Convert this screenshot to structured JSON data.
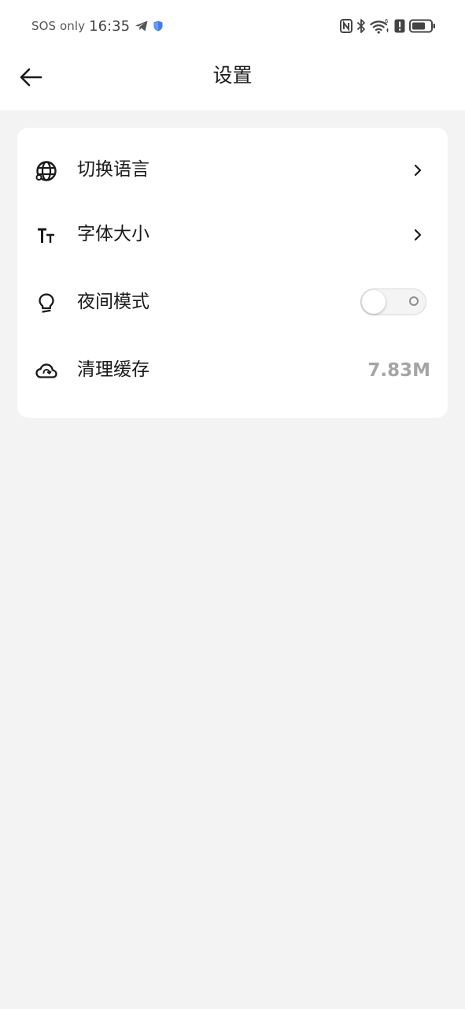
{
  "status_bar": {
    "carrier": "SOS only",
    "time": "16:35",
    "icons": [
      "telegram-icon",
      "shield-icon",
      "nfc-icon",
      "bluetooth-icon",
      "wifi-icon",
      "alert-icon",
      "battery-icon"
    ],
    "wifi_badge": "6"
  },
  "header": {
    "title": "设置",
    "back_icon": "arrow-left-icon"
  },
  "settings": {
    "language": {
      "label": "切换语言",
      "icon": "globe-icon"
    },
    "font_size": {
      "label": "字体大小",
      "icon": "text-size-icon"
    },
    "night_mode": {
      "label": "夜间模式",
      "icon": "lightbulb-icon",
      "enabled": false
    },
    "clear_cache": {
      "label": "清理缓存",
      "icon": "cloud-icon",
      "value": "7.83M"
    }
  },
  "colors": {
    "background": "#f3f3f3",
    "card": "#ffffff",
    "value_text": "#a5a5a5",
    "shield_accent": "#3f7cf0"
  }
}
